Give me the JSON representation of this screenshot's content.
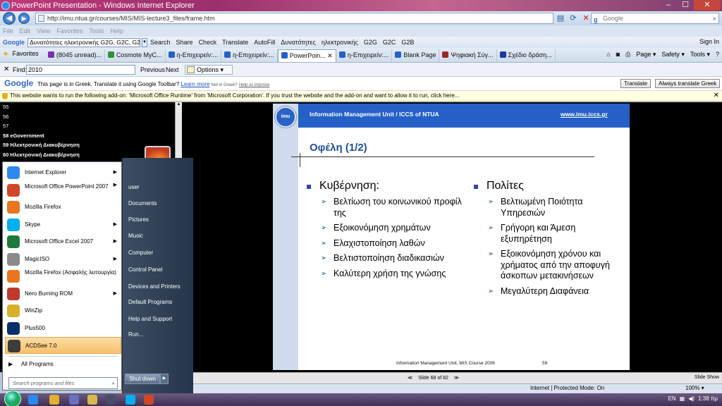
{
  "window": {
    "title": "PowerPoint Presentation - Windows Internet Explorer",
    "min": "–",
    "max": "☐",
    "close": "✕"
  },
  "address": {
    "url": "http://imu.ntua.gr/courses/MIS/MIS-lecture3_files/frame.htm",
    "search_placeholder": "Google",
    "search_engine_icon": "google-icon"
  },
  "menu": [
    "File",
    "Edit",
    "View",
    "Favorites",
    "Tools",
    "Help"
  ],
  "google_toolbar": {
    "logo": "Google",
    "query": "Δυνατότητες ηλεκτρονικής G2G, G2C, G2B",
    "buttons": [
      "Search",
      "Share",
      "Check",
      "Translate",
      "AutoFill",
      "Δυνατότητες",
      "ηλεκτρονικής",
      "G2G",
      "G2C",
      "G2B"
    ],
    "signin": "Sign In"
  },
  "favorites": {
    "label": "Favorites",
    "tabs": [
      {
        "label": "(8045 unread)...",
        "color": "#7a2fb0"
      },
      {
        "label": "Cosmote MyC...",
        "color": "#2f8f3a"
      },
      {
        "label": "η-Επιχειρείν:...",
        "color": "#2560c7"
      },
      {
        "label": "η-Επιχειρείν:...",
        "color": "#2560c7"
      },
      {
        "label": "PowerPoin...",
        "color": "#2560c7",
        "active": true
      },
      {
        "label": "η-Επιχειρείν:...",
        "color": "#2560c7"
      },
      {
        "label": "Blank Page",
        "color": "#2560c7"
      },
      {
        "label": "Ψηφιακή Σύγ...",
        "color": "#9a2a2a"
      },
      {
        "label": "Σχέδιο δράση...",
        "color": "#1a3aa0"
      }
    ],
    "commands": [
      "Page ▾",
      "Safety ▾",
      "Tools ▾"
    ]
  },
  "findbar": {
    "close": "✕",
    "label": "Find:",
    "value": "2010",
    "previous": "Previous",
    "next": "Next",
    "options": "Options ▾"
  },
  "translate": {
    "logo": "Google",
    "message": "This page is in Greek.  Translate it using Google Toolbar?",
    "learn_more": "Learn more",
    "not_greek": "Not in Greek?",
    "help_improve": "Help us improve",
    "translate_btn": "Translate",
    "always_btn": "Always translate Greek"
  },
  "infobar": {
    "text": "This website wants to run the following add-on: 'Microsoft Office Runtime' from 'Microsoft Corporation'. If you trust the website and the add-on and want to allow it to run, click here...",
    "close": "✕"
  },
  "slide_list": [
    {
      "text": "55",
      "bold": false
    },
    {
      "text": "56",
      "bold": false
    },
    {
      "text": "57",
      "bold": false
    },
    {
      "text": "58 eGovernment",
      "bold": true
    },
    {
      "text": "59 Ηλεκτρονική Διακυβέρνηση",
      "bold": true
    },
    {
      "text": "60 Ηλεκτρονική Διακυβέρνηση",
      "bold": true
    }
  ],
  "slide": {
    "logo": "imu",
    "header_left": "Information Management Unit / ICCS of NTUA",
    "header_right": "www.imu.iccs.gr",
    "title": "Οφέλη (1/2)",
    "left_head": "Κυβέρνηση:",
    "left_items": [
      "Βελτίωση του κοινωνικού προφίλ της",
      "Εξοικονόμηση χρημάτων",
      "Ελαχιστοποίηση λαθών",
      "Βελτιστοποίηση διαδικασιών",
      "Καλύτερη χρήση της γνώσης"
    ],
    "right_head": "Πολίτες",
    "right_items": [
      "Βελτιωμένη Ποιότητα Υπηρεσιών",
      "Γρήγορη και Άμεση εξυπηρέτηση",
      "Εξοικονόμηση χρόνου και χρήματος από την αποφυγή άσκοπων μετακινήσεων",
      "Μεγαλύτερη Διαφάνεια"
    ],
    "footer": "Information Management Unit, MIS Course 2006",
    "page": "59"
  },
  "start_menu": {
    "left_items": [
      {
        "label": "Internet Explorer",
        "icon": "internet-explorer-icon",
        "color": "#2d89ef",
        "arrow": true
      },
      {
        "label": "Microsoft Office PowerPoint 2007",
        "icon": "powerpoint-icon",
        "color": "#d24726",
        "arrow": true
      },
      {
        "label": "Mozilla Firefox",
        "icon": "firefox-icon",
        "color": "#e8761e",
        "arrow": false
      },
      {
        "label": "Skype",
        "icon": "skype-icon",
        "color": "#00aff0",
        "arrow": true
      },
      {
        "label": "Microsoft Office Excel 2007",
        "icon": "excel-icon",
        "color": "#1f7a3e",
        "arrow": true
      },
      {
        "label": "MagicISO",
        "icon": "magiciso-icon",
        "color": "#8a8a8a",
        "arrow": true
      },
      {
        "label": "Mozilla Firefox (Ασφαλής λειτουργία)",
        "icon": "firefox-icon",
        "color": "#e8761e",
        "arrow": false
      },
      {
        "label": "Nero Burning ROM",
        "icon": "nero-icon",
        "color": "#c0392b",
        "arrow": true
      },
      {
        "label": "WinZip",
        "icon": "winzip-icon",
        "color": "#d8b02a",
        "arrow": false
      },
      {
        "label": "Plus500",
        "icon": "plus500-icon",
        "color": "#0b2f6b",
        "arrow": false
      },
      {
        "label": "ACDSee 7.0",
        "icon": "acdsee-icon",
        "color": "#3c3c3c",
        "arrow": false,
        "selected": true
      }
    ],
    "all_programs": "All Programs",
    "search_placeholder": "Search programs and files",
    "right_items": [
      "user",
      "Documents",
      "Pictures",
      "Music",
      "Computer",
      "Control Panel",
      "Devices and Printers",
      "Default Programs",
      "Help and Support",
      "Run..."
    ],
    "shutdown": "Shut down"
  },
  "ppt_status": {
    "slide_counter": "Slide 68 of 82",
    "slide_show": "Slide Show"
  },
  "ie_status": {
    "zone": "Internet | Protected Mode: On",
    "zoom": "100% ▾"
  },
  "taskbar": {
    "lang": "EN",
    "time": "1:38 πμ"
  }
}
